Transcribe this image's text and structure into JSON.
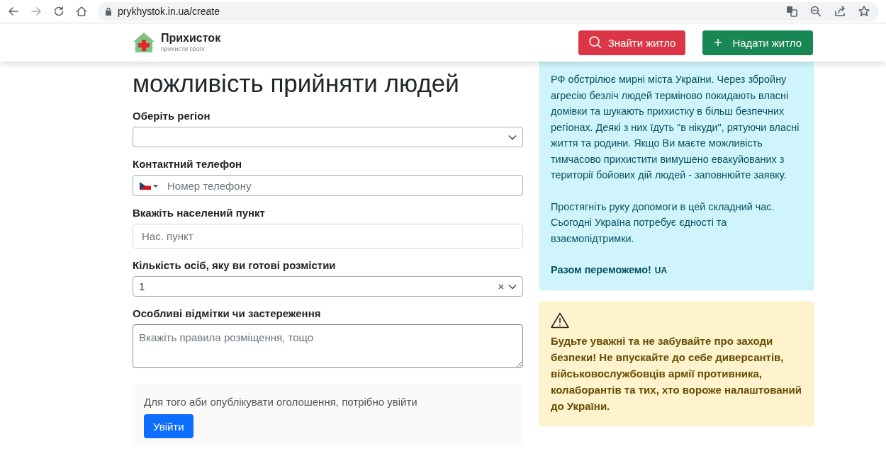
{
  "browser": {
    "url": "prykhystok.in.ua/create"
  },
  "header": {
    "brand": "Прихисток",
    "tagline": "прихисти своїх",
    "buttons": [
      {
        "label": "Знайти житло",
        "kind": "find"
      },
      {
        "label": "Надати житло",
        "kind": "offer"
      }
    ]
  },
  "form": {
    "heading": "можливість прийняти людей",
    "fields": [
      {
        "kind": "select",
        "label": "Оберіть регіон"
      },
      {
        "kind": "phone",
        "label": "Контактний телефон",
        "placeholder": "Номер телефону"
      },
      {
        "kind": "text",
        "label": "Вкажіть населений пункт",
        "placeholder": "Нас. пункт"
      },
      {
        "kind": "select",
        "label": "Кількість осіб, яку ви готові розмістии",
        "value": "1",
        "clearable": true
      },
      {
        "kind": "textarea",
        "label": "Особливі відмітки чи застереження",
        "placeholder": "Вкажіть правила розміщення, тощо"
      }
    ],
    "login": {
      "text": "Для того аби опублікувати оголошення, потрібно увійти",
      "button": "Увійти"
    }
  },
  "info": {
    "paragraphs": [
      "РФ обстрілює мирні міста України. Через збройну агресію безліч людей терміново покидають власні домівки та шукають прихистку в більш безпечних регіонах. Деякі з них їдуть \"в нікуди\", рятуючи власні життя та родини. Якщо Ви маєте можливість тимчасово прихистити вимушено евакуйованих з території бойових дій людей - заповнюйте заявку.",
      "Простягніть руку допомоги в цей складний час. Сьогодні Україна потребує єдності та взаємопідтримки."
    ],
    "closing": "Разом переможемо!",
    "closing_tag": "UA"
  },
  "warning": {
    "text": "Будьте уважні та не забувайте про заходи безпеки! Не впускайте до себе диверсантів, військовослужбовців армії противника, колаборантів та тих, хто вороже налаштований до України."
  }
}
